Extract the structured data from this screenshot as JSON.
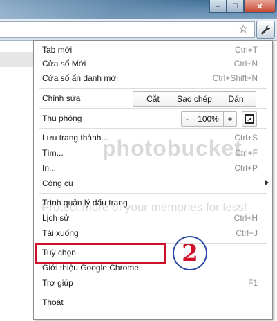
{
  "window": {
    "minimize_label": "–",
    "maximize_label": "□",
    "close_label": "✕"
  },
  "toolbar": {
    "star_icon": "star-icon",
    "wrench_icon": "wrench-icon"
  },
  "menu": {
    "new_tab": {
      "label": "Tab mới",
      "shortcut": "Ctrl+T"
    },
    "new_window": {
      "label": "Cửa sổ Mới",
      "shortcut": "Ctrl+N"
    },
    "incognito": {
      "label": "Cửa sổ ẩn danh mới",
      "shortcut": "Ctrl+Shift+N"
    },
    "edit": {
      "label": "Chỉnh sửa",
      "cut": "Cắt",
      "copy": "Sao chép",
      "paste": "Dán"
    },
    "zoom": {
      "label": "Thu phóng",
      "minus": "-",
      "value": "100%",
      "plus": "+"
    },
    "save_page": {
      "label": "Lưu trang thành...",
      "shortcut": "Ctrl+S"
    },
    "find": {
      "label": "Tìm...",
      "shortcut": "Ctrl+F"
    },
    "print": {
      "label": "In...",
      "shortcut": "Ctrl+P"
    },
    "tools": {
      "label": "Công cụ"
    },
    "bookmark_manager": {
      "label": "Trình quản lý dấu trang"
    },
    "history": {
      "label": "Lịch sử",
      "shortcut": "Ctrl+H"
    },
    "downloads": {
      "label": "Tải xuống",
      "shortcut": "Ctrl+J"
    },
    "options": {
      "label": "Tuỳ chọn"
    },
    "about": {
      "label": "Giới thiệu Google Chrome"
    },
    "help": {
      "label": "Trợ giúp",
      "shortcut": "F1"
    },
    "exit": {
      "label": "Thoát"
    }
  },
  "annotation": {
    "step_number": "2",
    "highlight_color": "#d0112b",
    "circle_color": "#2b4aa5"
  },
  "watermark": {
    "brand": "photobucket",
    "tagline": "Protect more of your memories for less!"
  }
}
